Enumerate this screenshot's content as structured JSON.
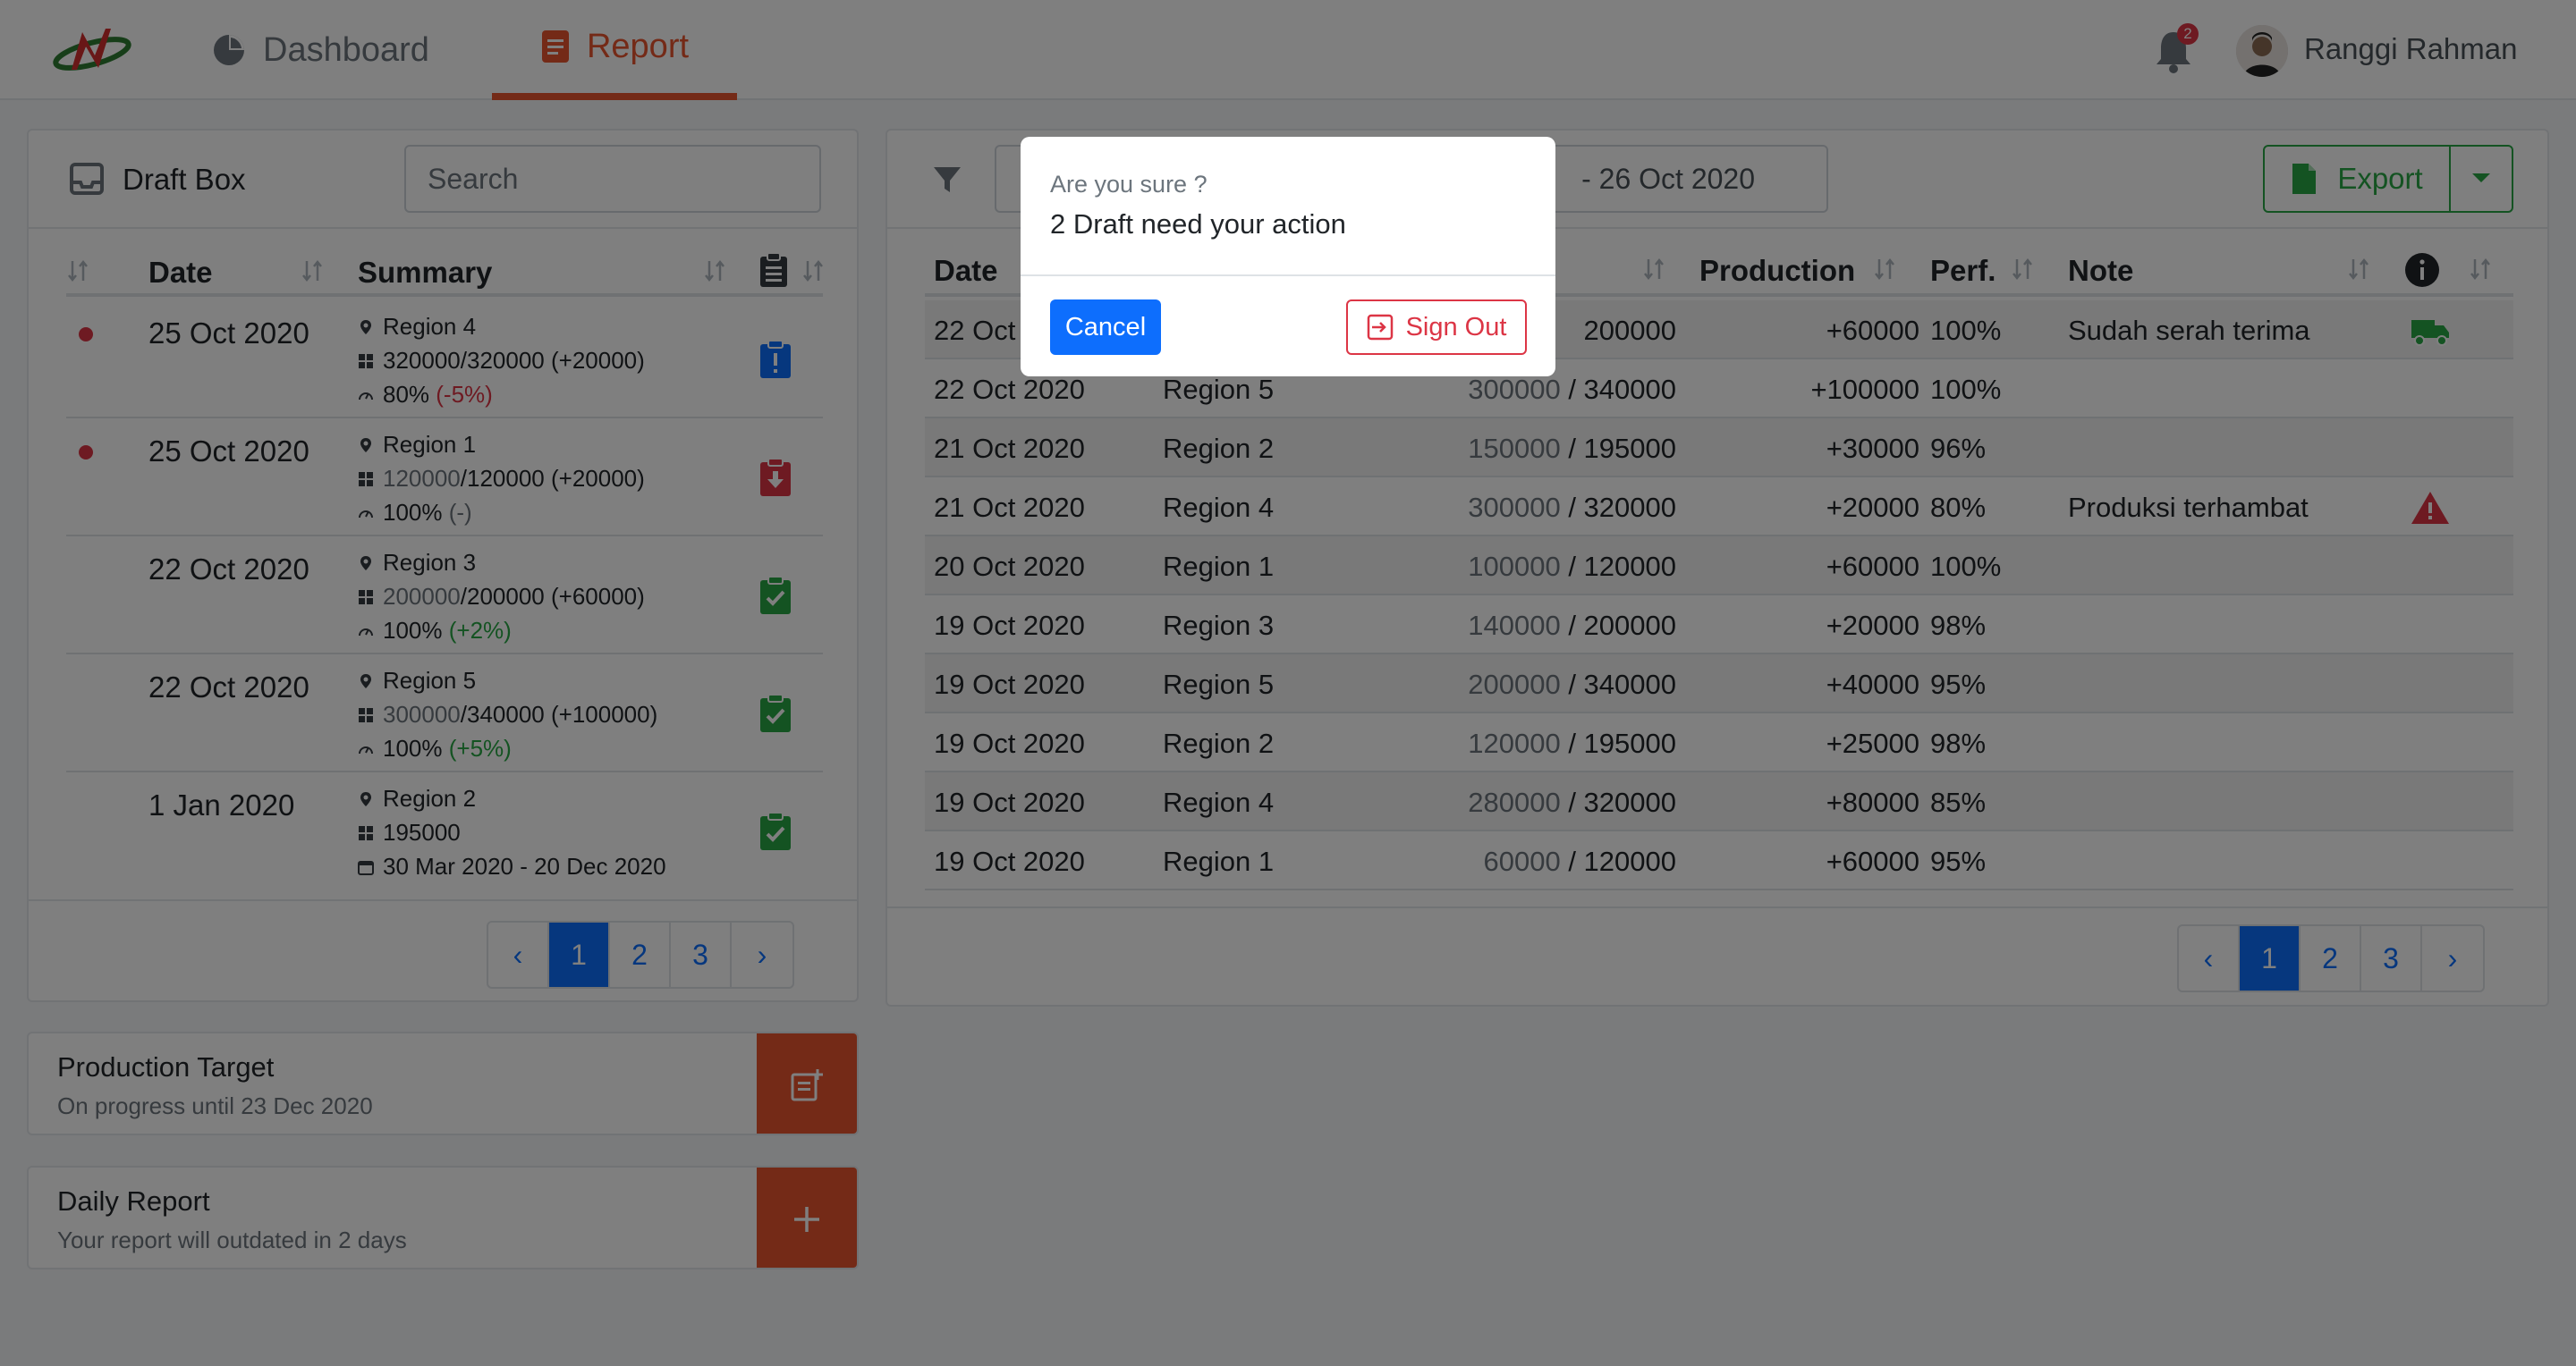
{
  "nav": {
    "tabs": [
      {
        "label": "Dashboard",
        "icon": "pie-chart-icon"
      },
      {
        "label": "Report",
        "icon": "document-icon",
        "active": true
      }
    ],
    "notification_count": "2",
    "user_name": "Ranggi Rahman"
  },
  "draft_box": {
    "title": "Draft Box",
    "search_placeholder": "Search",
    "headers": {
      "date": "Date",
      "summary": "Summary"
    },
    "rows": [
      {
        "unread": true,
        "date": "25 Oct 2020",
        "region": "Region 4",
        "prod_a": "320000",
        "prod_b": "/320000 (+20000)",
        "perf": "80% ",
        "perf_delta": "(-5%)",
        "status": "info"
      },
      {
        "unread": true,
        "date": "25 Oct 2020",
        "region": "Region 1",
        "prod_a": "120000",
        "prod_b": "/120000 (+20000)",
        "perf": "100% ",
        "perf_delta": "(-)",
        "status": "pending"
      },
      {
        "unread": false,
        "date": "22 Oct 2020",
        "region": "Region 3",
        "prod_a": "200000",
        "prod_b": "/200000 (+60000)",
        "perf": "100% ",
        "perf_delta": "(+2%)",
        "status": "done"
      },
      {
        "unread": false,
        "date": "22 Oct 2020",
        "region": "Region 5",
        "prod_a": "300000",
        "prod_b": "/340000 (+100000)",
        "perf": "100% ",
        "perf_delta": "(+5%)",
        "status": "done"
      },
      {
        "unread": false,
        "date": "1 Jan 2020",
        "region": "Region 2",
        "prod_a": "195000",
        "prod_b": "",
        "perf": "30 Mar 2020 - 20 Dec 2020",
        "perf_delta": "",
        "status": "done"
      }
    ],
    "pagination": [
      "‹",
      "1",
      "2",
      "3",
      "›"
    ]
  },
  "widgets": {
    "target": {
      "title": "Production Target",
      "subtitle": "On progress until 23 Dec 2020"
    },
    "daily": {
      "title": "Daily Report",
      "subtitle": "Your report will outdated in 2 days"
    }
  },
  "report": {
    "date_range": "- 26 Oct 2020",
    "export_label": "Export",
    "headers": {
      "date": "Date",
      "production": "Production",
      "perf": "Perf.",
      "note": "Note"
    },
    "rows": [
      {
        "date": "22 Oct",
        "region": "",
        "prod_a": "",
        "prod_b": "200000",
        "inc": "+60000",
        "perf": "100%",
        "note": "Sudah serah terima",
        "icon": "truck"
      },
      {
        "date": "22 Oct 2020",
        "region": "Region 5",
        "prod_a": "300000",
        "prod_b": " / 340000",
        "inc": "+100000",
        "perf": "100%",
        "note": "",
        "icon": ""
      },
      {
        "date": "21 Oct 2020",
        "region": "Region 2",
        "prod_a": "150000",
        "prod_b": " / 195000",
        "inc": "+30000",
        "perf": "96%",
        "note": "",
        "icon": ""
      },
      {
        "date": "21 Oct 2020",
        "region": "Region 4",
        "prod_a": "300000",
        "prod_b": " / 320000",
        "inc": "+20000",
        "perf": "80%",
        "note": "Produksi terhambat",
        "icon": "warning"
      },
      {
        "date": "20 Oct 2020",
        "region": "Region 1",
        "prod_a": "100000",
        "prod_b": " / 120000",
        "inc": "+60000",
        "perf": "100%",
        "note": "",
        "icon": ""
      },
      {
        "date": "19 Oct 2020",
        "region": "Region 3",
        "prod_a": "140000",
        "prod_b": " / 200000",
        "inc": "+20000",
        "perf": "98%",
        "note": "",
        "icon": ""
      },
      {
        "date": "19 Oct 2020",
        "region": "Region 5",
        "prod_a": "200000",
        "prod_b": " / 340000",
        "inc": "+40000",
        "perf": "95%",
        "note": "",
        "icon": ""
      },
      {
        "date": "19 Oct 2020",
        "region": "Region 2",
        "prod_a": "120000",
        "prod_b": " / 195000",
        "inc": "+25000",
        "perf": "98%",
        "note": "",
        "icon": ""
      },
      {
        "date": "19 Oct 2020",
        "region": "Region 4",
        "prod_a": "280000",
        "prod_b": " / 320000",
        "inc": "+80000",
        "perf": "85%",
        "note": "",
        "icon": ""
      },
      {
        "date": "19 Oct 2020",
        "region": "Region 1",
        "prod_a": "60000",
        "prod_b": " / 120000",
        "inc": "+60000",
        "perf": "95%",
        "note": "",
        "icon": ""
      }
    ],
    "pagination": [
      "‹",
      "1",
      "2",
      "3",
      "›"
    ]
  },
  "modal": {
    "subtitle": "Are you sure ?",
    "title": "2 Draft need your action",
    "cancel_label": "Cancel",
    "signout_label": "Sign Out"
  },
  "colors": {
    "accent": "#e8552f",
    "primary": "#0d6efd",
    "success": "#28a745",
    "danger": "#dc3545"
  }
}
